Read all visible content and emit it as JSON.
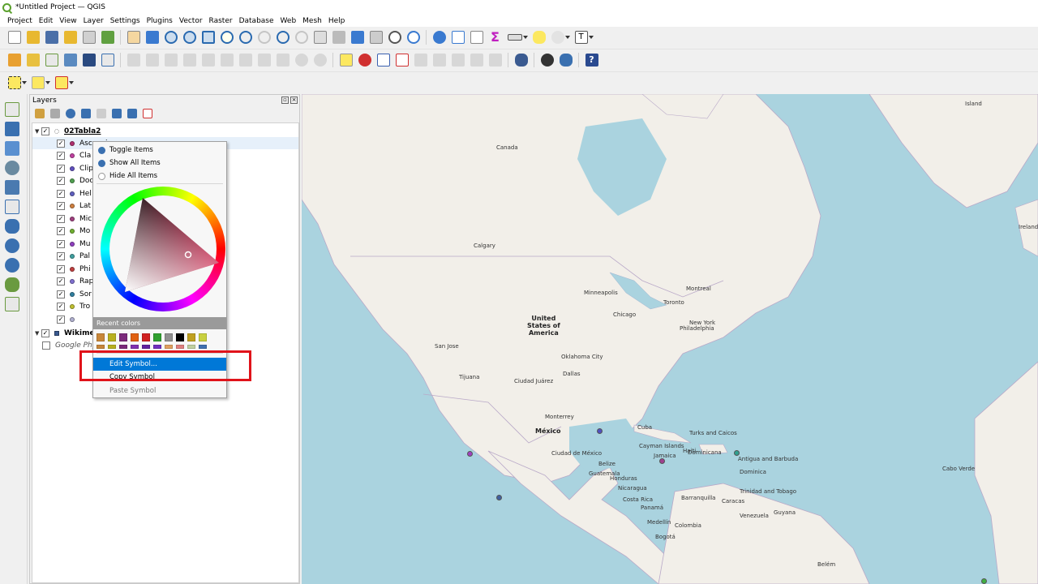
{
  "window": {
    "title": "*Untitled Project — QGIS"
  },
  "menubar": [
    "Project",
    "Edit",
    "View",
    "Layer",
    "Settings",
    "Plugins",
    "Vector",
    "Raster",
    "Database",
    "Web",
    "Mesh",
    "Help"
  ],
  "layers_panel": {
    "title": "Layers",
    "group": {
      "name": "02Tabla2",
      "checked": true
    },
    "items": [
      {
        "label": "Ascencion",
        "color": "#b03070"
      },
      {
        "label": "Cla",
        "color": "#c040a0"
      },
      {
        "label": "Clip",
        "color": "#6050c0"
      },
      {
        "label": "Doc",
        "color": "#50a050"
      },
      {
        "label": "Hel",
        "color": "#6060c0"
      },
      {
        "label": "Lat",
        "color": "#d08040"
      },
      {
        "label": "Mic",
        "color": "#a04080"
      },
      {
        "label": "Mo",
        "color": "#70b030"
      },
      {
        "label": "Mu",
        "color": "#9040c0"
      },
      {
        "label": "Pal",
        "color": "#40a0a0"
      },
      {
        "label": "Phi",
        "color": "#c04040"
      },
      {
        "label": "Rap",
        "color": "#8070d0"
      },
      {
        "label": "Sor",
        "color": "#3080a0"
      },
      {
        "label": "Tro",
        "color": "#c0c030"
      },
      {
        "label": "",
        "color": "#b0b0d0"
      }
    ],
    "basemap_group": "Wikime",
    "basemap_layer": "Google Phy"
  },
  "context_menu": {
    "toggle": "Toggle Items",
    "show_all": "Show All Items",
    "hide_all": "Hide All Items",
    "recent_colors": "Recent colors",
    "edit_symbol": "Edit Symbol...",
    "copy_symbol": "Copy Symbol",
    "paste_symbol": "Paste Symbol",
    "swatches_row1": [
      "#c8873a",
      "#b8b020",
      "#7b2a7b",
      "#e06010",
      "#d02020",
      "#30a030",
      "#909090",
      "#000000",
      "#c0a020",
      "#c8d040"
    ],
    "swatches_row2": [
      "#c8873a",
      "#b8b020",
      "#7b2a7b",
      "#8030b0",
      "#6020a0",
      "#7030c0",
      "#e0a060",
      "#e08080",
      "#c0d0a0",
      "#4070b0"
    ],
    "current_color": "#c0103a"
  },
  "map": {
    "labels": {
      "greenland": "Island",
      "canada": "Canada",
      "iceland": "Ireland",
      "calgary": "Calgary",
      "minneapolis": "Minneapolis",
      "montreal": "Montreal",
      "toronto": "Toronto",
      "chicago": "Chicago",
      "usa": "United\nStates of\nAmerica",
      "newyork": "New York",
      "philadelphia": "Philadelphia",
      "sanjose": "San Jose",
      "oklahoma": "Oklahoma City",
      "dallas": "Dallas",
      "tijuana": "Tijuana",
      "juarez": "Ciudad Juárez",
      "monterrey": "Monterrey",
      "mexico": "México",
      "cuba": "Cuba",
      "mexicocity": "Ciudad de México",
      "cayman": "Cayman Islands",
      "jamaica": "Jamaica",
      "haiti": "Haiti",
      "dominicana": "Dominicana",
      "belize": "Belize",
      "guatemala": "Guatemala",
      "honduras": "Honduras",
      "nicaragua": "Nicaragua",
      "costarica": "Costa Rica",
      "panama": "Panamá",
      "barranquilla": "Barranquilla",
      "caracas": "Caracas",
      "trinidad": "Trinidad and Tobago",
      "antigua": "Antigua and Barbuda",
      "dominica": "Dominica",
      "turks": "Turks and Caicos",
      "colombia": "Colombia",
      "venezuela": "Venezuela",
      "guyana": "Guyana",
      "capeverde": "Cabo Verde",
      "belem": "Belém",
      "bogota": "Bogotá",
      "medellin": "Medellín"
    },
    "points": [
      {
        "name": "p1",
        "color": "#a040c0"
      },
      {
        "name": "p2",
        "color": "#5050c0"
      },
      {
        "name": "p3",
        "color": "#4060a0"
      },
      {
        "name": "p4",
        "color": "#a04090"
      },
      {
        "name": "p5",
        "color": "#30a090"
      },
      {
        "name": "p6",
        "color": "#40b040"
      }
    ]
  }
}
